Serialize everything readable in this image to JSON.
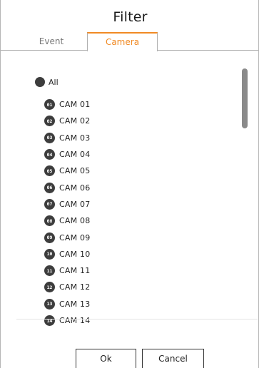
{
  "dialog": {
    "title": "Filter"
  },
  "tabs": [
    {
      "label": "Event",
      "active": false
    },
    {
      "label": "Camera",
      "active": true
    }
  ],
  "all_option": {
    "label": "All"
  },
  "cameras": [
    {
      "badge": "01",
      "label": "CAM 01"
    },
    {
      "badge": "02",
      "label": "CAM 02"
    },
    {
      "badge": "03",
      "label": "CAM 03"
    },
    {
      "badge": "04",
      "label": "CAM 04"
    },
    {
      "badge": "05",
      "label": "CAM 05"
    },
    {
      "badge": "06",
      "label": "CAM 06"
    },
    {
      "badge": "07",
      "label": "CAM 07"
    },
    {
      "badge": "08",
      "label": "CAM 08"
    },
    {
      "badge": "09",
      "label": "CAM 09"
    },
    {
      "badge": "10",
      "label": "CAM 10"
    },
    {
      "badge": "11",
      "label": "CAM 11"
    },
    {
      "badge": "12",
      "label": "CAM 12"
    },
    {
      "badge": "13",
      "label": "CAM 13"
    },
    {
      "badge": "14",
      "label": "CAM 14"
    }
  ],
  "buttons": {
    "ok_label": "Ok",
    "cancel_label": "Cancel"
  },
  "colors": {
    "accent": "#f08a24",
    "badge": "#3d3d3d",
    "scrollbar": "#8a8a8a"
  }
}
